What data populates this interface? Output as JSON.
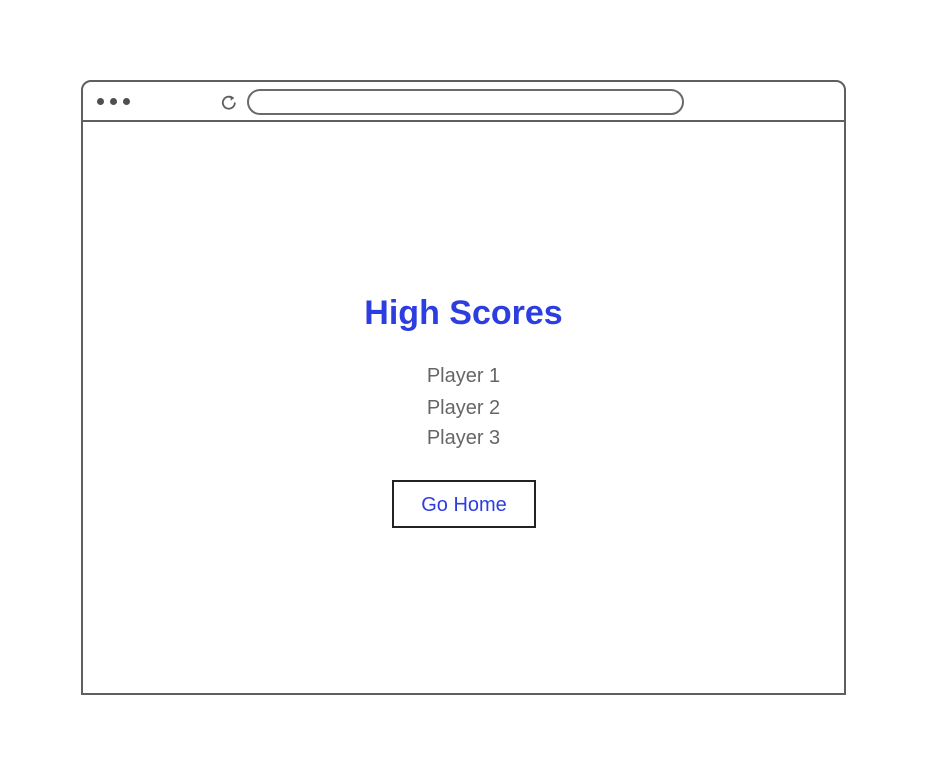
{
  "browser": {
    "address_bar_value": ""
  },
  "page": {
    "title": "High Scores",
    "players": [
      "Player 1",
      "Player 2",
      "Player 3"
    ],
    "go_home_label": "Go Home"
  },
  "colors": {
    "accent": "#2c3ee0",
    "muted_text": "#666666",
    "frame": "#5f5f5f"
  }
}
